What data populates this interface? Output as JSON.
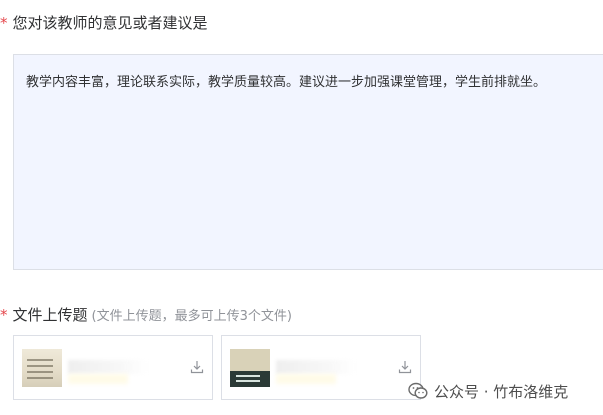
{
  "question1": {
    "required_mark": "*",
    "label": "您对该教师的意见或者建议是",
    "answer": "教学内容丰富，理论联系实际，教学质量较高。建议进一步加强课堂管理，学生前排就坐。"
  },
  "question2": {
    "required_mark": "*",
    "label": "文件上传题",
    "hint": "(文件上传题，最多可上传3个文件)",
    "files": [
      {
        "icon": "download-icon"
      },
      {
        "icon": "download-icon"
      }
    ]
  },
  "watermark": {
    "text": "公众号 · 竹布洛维克",
    "icon": "wechat-icon"
  },
  "colors": {
    "required": "#e5484d",
    "answer_bg": "#f2f5ff",
    "border": "#dcdfe6",
    "hint": "#909399"
  }
}
